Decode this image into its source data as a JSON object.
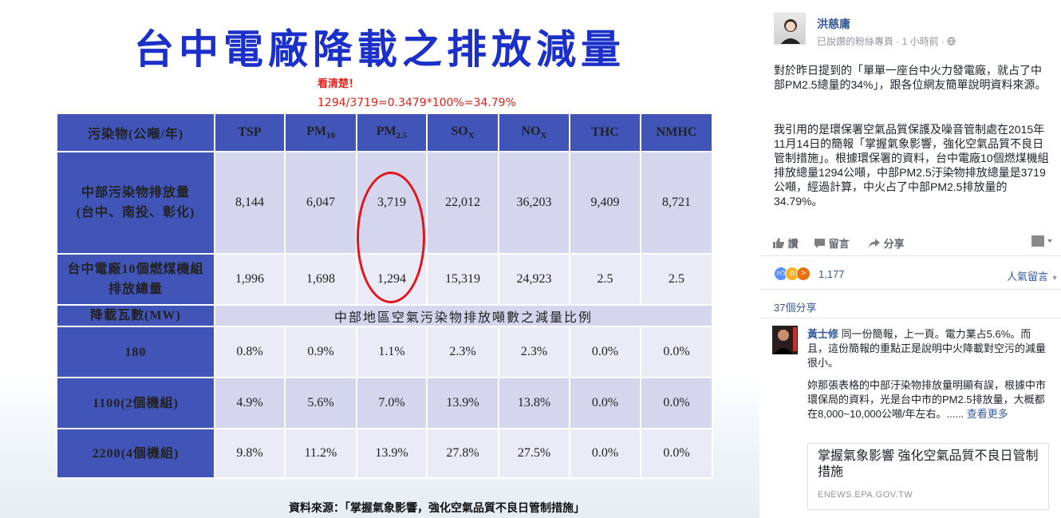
{
  "slide": {
    "title": "台中電廠降載之排放減量",
    "note": "看清楚！",
    "formula": "1294/3719=0.3479*100%=34.79%",
    "header": {
      "first": "污染物(公噸/年)",
      "tsp": "TSP",
      "pm10_main": "PM",
      "pm10_sub": "10",
      "pm25_main": "PM",
      "pm25_sub": "2.5",
      "sox_main": "SO",
      "sox_sub": "X",
      "nox_main": "NO",
      "nox_sub": "X",
      "thc": "THC",
      "nmhc": "NMHC"
    },
    "rows": [
      {
        "label1": "中部污染物排放量",
        "label2": "(台中、南投、彰化)",
        "values": [
          "8,144",
          "6,047",
          "3,719",
          "22,012",
          "36,203",
          "9,409",
          "8,721"
        ]
      },
      {
        "label1": "台中電廠10個燃煤機組",
        "label2": "排放總量",
        "values": [
          "1,996",
          "1,698",
          "1,294",
          "15,319",
          "24,923",
          "2.5",
          "2.5"
        ]
      }
    ],
    "band": {
      "label": "降載瓦數(MW)",
      "text": "中部地區空氣污染物排放噸數之減量比例"
    },
    "pct_rows": [
      {
        "label": "180",
        "values": [
          "0.8%",
          "0.9%",
          "1.1%",
          "2.3%",
          "2.3%",
          "0.0%",
          "0.0%"
        ]
      },
      {
        "label": "1100(2個機組)",
        "values": [
          "4.9%",
          "5.6%",
          "7.0%",
          "13.9%",
          "13.8%",
          "0.0%",
          "0.0%"
        ]
      },
      {
        "label": "2200(4個機組)",
        "values": [
          "9.8%",
          "11.2%",
          "13.9%",
          "27.8%",
          "27.5%",
          "0.0%",
          "0.0%"
        ]
      }
    ],
    "source": "資料來源：「掌握氣象影響，強化空氣品質不良日管制措施」"
  },
  "post": {
    "author": "洪慈庸",
    "meta": "已說讚的粉絲專頁 · 1 小時前 · ",
    "globe_icon": "globe-icon",
    "paragraph1": "對於昨日提到的「單單一座台中火力發電廠，就占了中部PM2.5總量的34%」，跟各位網友簡單說明資料來源。",
    "paragraph2": "我引用的是環保署空氣品質保護及噪音管制處在2015年11月14日的簡報「掌握氣象影響，強化空氣品質不良日管制措施」。根據環保署的資料，台中電廠10個燃煤機組排放總量1294公噸，中部PM2.5汙染物排放總量是3719公噸，經過計算，中火占了中部PM2.5排放量的34.79%。",
    "actions": {
      "like": "讚",
      "comment": "留言",
      "share": "分享"
    },
    "reaction_count": "1,177",
    "sort_label": "人氣留言",
    "shares": "37個分享",
    "comment": {
      "name": "黃士修",
      "text": "同一份簡報，上一頁。電力業占5.6%。而且，這份簡報的重點正是說明中火降載對空污的減量很小。",
      "text2": "妳那張表格的中部汙染物排放量明顯有誤，根據中市環保局的資料，光是台中市的PM2.5排放量，大概都在8,000~10,000公噸/年左右。......",
      "see_more": "查看更多"
    },
    "card": {
      "title": "掌握氣象影響 強化空氣品質不良日管制措施",
      "domain": "ENEWS.EPA.GOV.TW"
    },
    "colors": {
      "link": "#365899",
      "like_blue": "#5890ff",
      "wow_yellow": "#f7b125",
      "angry_red": "#e9710f"
    }
  }
}
